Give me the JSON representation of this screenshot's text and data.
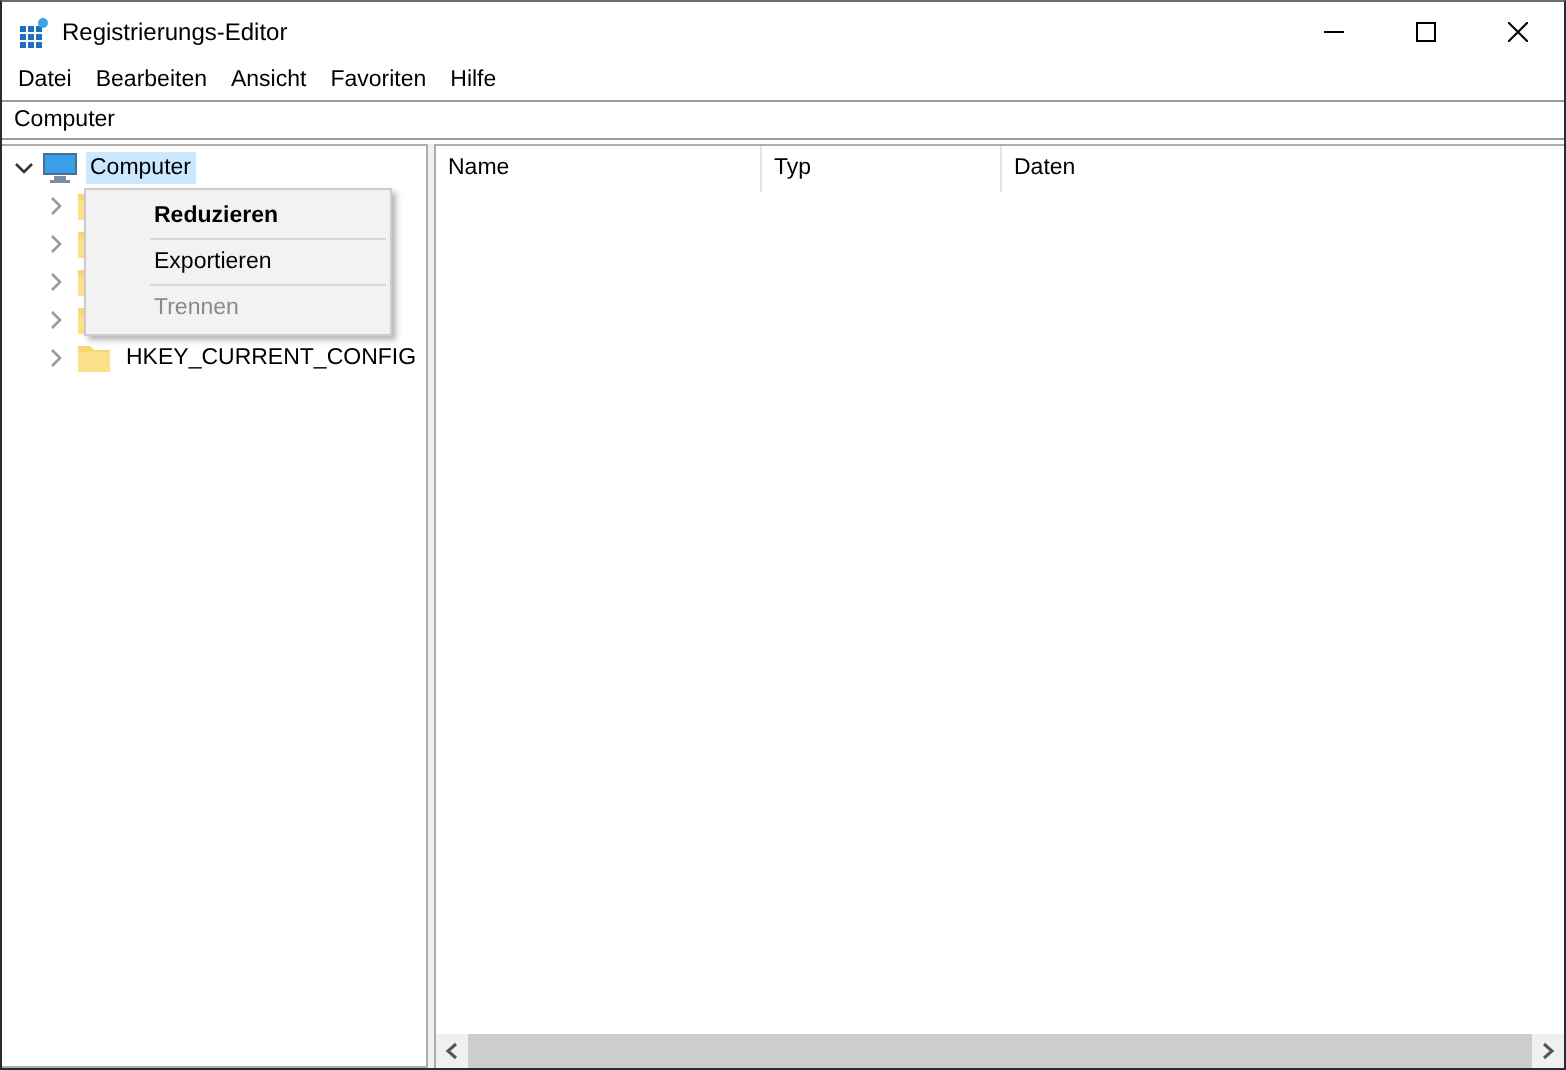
{
  "window": {
    "title": "Registrierungs-Editor"
  },
  "menu_bar": [
    "Datei",
    "Bearbeiten",
    "Ansicht",
    "Favoriten",
    "Hilfe"
  ],
  "address_bar": {
    "value": "Computer"
  },
  "tree": {
    "label": "Computer",
    "selected": true,
    "expanded": true,
    "children": [
      {
        "expanded": false
      },
      {
        "expanded": false
      },
      {
        "expanded": false
      },
      {
        "expanded": false
      },
      {
        "label": "HKEY_CURRENT_CONFIG",
        "expanded": false
      }
    ]
  },
  "columns": [
    "Name",
    "Typ",
    "Daten"
  ],
  "context_menu": [
    {
      "label": "Reduzieren",
      "default": true,
      "disabled": false
    },
    {
      "label": "Exportieren",
      "default": false,
      "disabled": false
    },
    {
      "label": "Trennen",
      "default": false,
      "disabled": true
    }
  ]
}
